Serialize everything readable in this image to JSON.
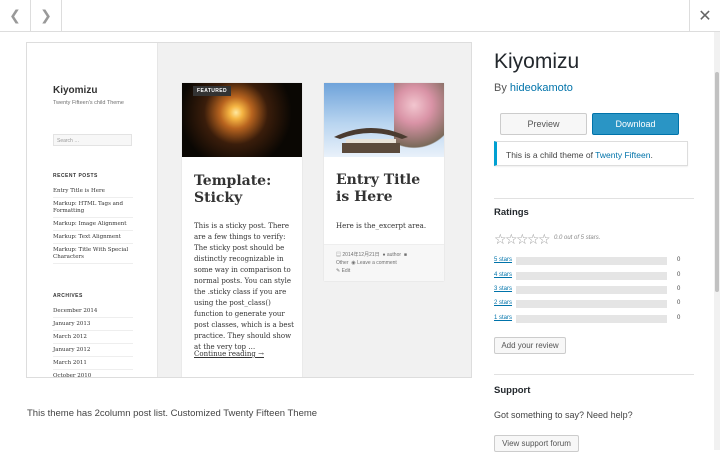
{
  "theme": {
    "name": "Kiyomizu",
    "by_label": "By",
    "author": "hideokamoto",
    "description": "This theme has 2column post list. Customized Twenty Fifteen Theme"
  },
  "actions": {
    "preview_label": "Preview",
    "download_label": "Download"
  },
  "notice": {
    "prefix": "This is a child theme of",
    "parent": "Twenty Fifteen",
    "suffix": "."
  },
  "ratings": {
    "heading": "Ratings",
    "summary": "0.0 out of 5 stars.",
    "stars_filled": 0,
    "rows": [
      {
        "label": "5 stars",
        "count": "0"
      },
      {
        "label": "4 stars",
        "count": "0"
      },
      {
        "label": "3 stars",
        "count": "0"
      },
      {
        "label": "2 stars",
        "count": "0"
      },
      {
        "label": "1 stars",
        "count": "0"
      }
    ],
    "add_review_label": "Add your review"
  },
  "support": {
    "heading": "Support",
    "text": "Got something to say? Need help?",
    "button_label": "View support forum"
  },
  "screenshot": {
    "site_title": "Kiyomizu",
    "site_desc": "Twenty Fifteen's child Theme",
    "search_placeholder": "Search …",
    "recent_heading": "RECENT POSTS",
    "recent_posts": [
      "Entry Title is Here",
      "Markup: HTML Tags and Formatting",
      "Markup: Image Alignment",
      "Markup: Text Alignment",
      "Markup: Title With Special Characters"
    ],
    "archives_heading": "ARCHIVES",
    "archives": [
      "December 2014",
      "January 2013",
      "March 2012",
      "January 2012",
      "March 2011",
      "October 2010"
    ],
    "post1": {
      "badge": "FEATURED",
      "title": "Template: Sticky",
      "body": "This is a sticky post. There are a few things to verify: The sticky post should be distinctly recognizable in some way in comparison to normal posts. You can style the .sticky class if you are using the post_class() function to generate your post classes, which is a best practice. They should show at the very top …",
      "more": "Continue reading →"
    },
    "post2": {
      "title": "Entry Title is Here",
      "excerpt": "Here is the_excerpt area.",
      "meta_date": "2014年12月21日",
      "meta_author": "author",
      "meta_cat": "Other",
      "meta_comment": "Leave a comment",
      "meta_edit": "Edit"
    }
  },
  "colors": {
    "accent": "#0073aa",
    "download": "#2a95c5",
    "notice_border": "#00a0d2"
  }
}
